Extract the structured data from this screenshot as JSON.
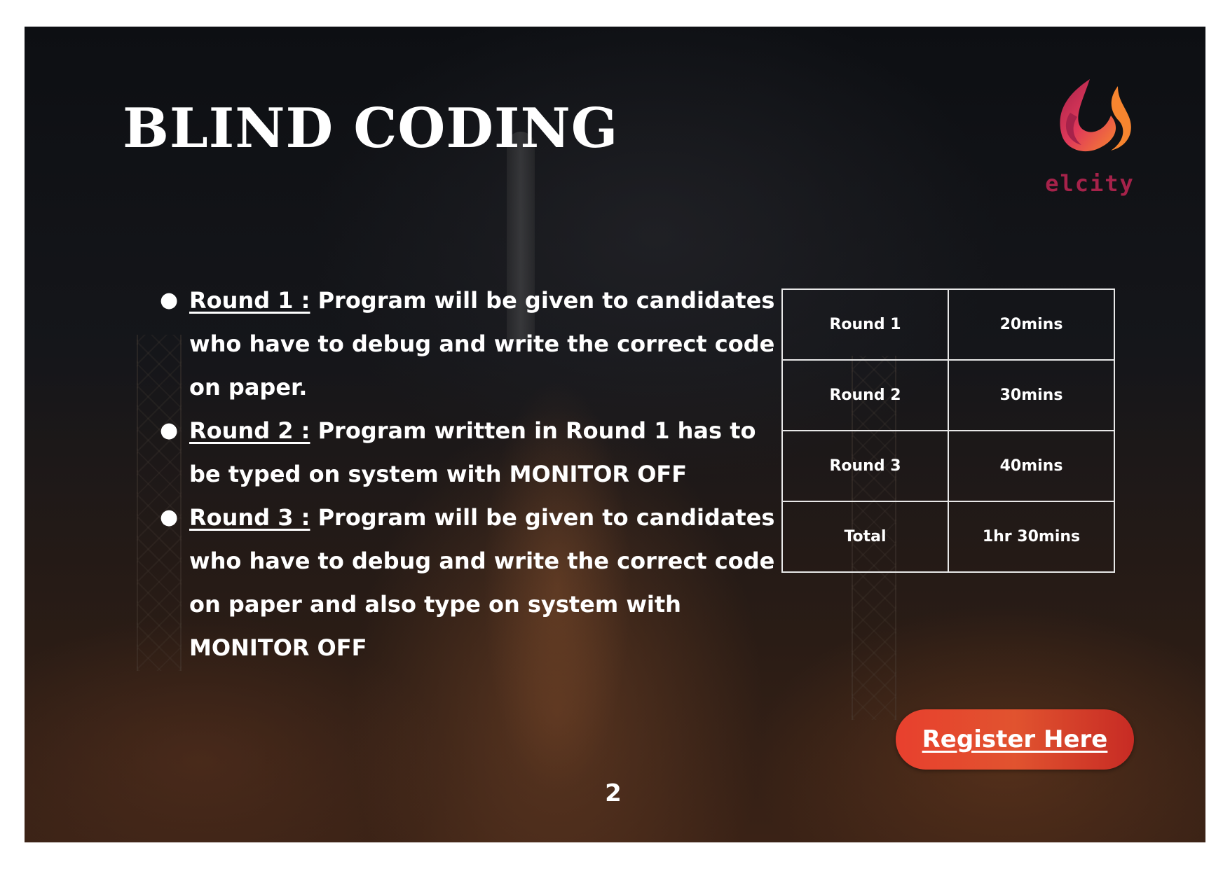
{
  "page": {
    "title": "BLIND CODING",
    "page_number": "2"
  },
  "logo": {
    "text": "elcity",
    "colors": {
      "flame_dark": "#a6224a",
      "flame_mid": "#e0395a",
      "flame_light": "#f7852f"
    }
  },
  "rounds": [
    {
      "label": "Round 1 :",
      "description": " Program will be given to candidates who have to debug and write the correct code on paper."
    },
    {
      "label": "Round 2 :",
      "description": " Program written in Round 1 has to be typed on system with MONITOR OFF"
    },
    {
      "label": "Round 3 :",
      "description": " Program will be given to candidates who have to debug and write the correct code on paper and also type on system with MONITOR OFF"
    }
  ],
  "schedule": {
    "rows": [
      {
        "round": "Round 1",
        "duration": "20mins"
      },
      {
        "round": "Round 2",
        "duration": "30mins"
      },
      {
        "round": "Round 3",
        "duration": "40mins"
      },
      {
        "round": "Total",
        "duration": "1hr 30mins"
      }
    ]
  },
  "register": {
    "label": "Register Here",
    "color": "#e1532f"
  }
}
